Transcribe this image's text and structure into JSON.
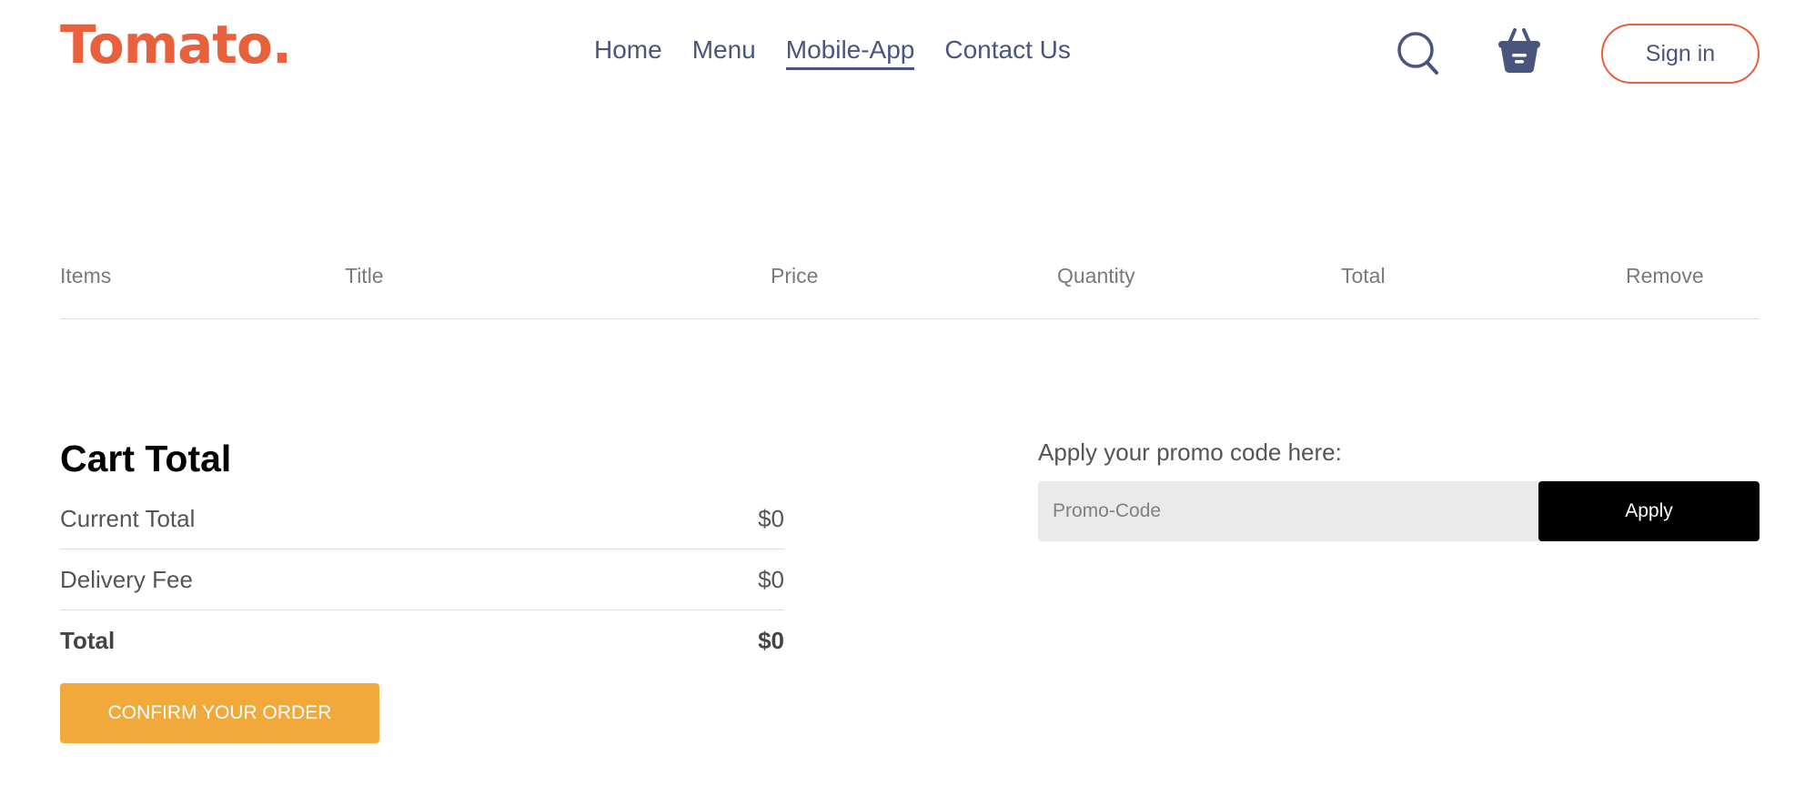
{
  "navbar": {
    "logo": "Tomato.",
    "menu": [
      {
        "label": "Home",
        "active": false
      },
      {
        "label": "Menu",
        "active": false
      },
      {
        "label": "Mobile-App",
        "active": true
      },
      {
        "label": "Contact Us",
        "active": false
      }
    ],
    "icons": {
      "search": "search-icon",
      "basket": "basket-icon"
    },
    "signin_label": "Sign in"
  },
  "cart_table": {
    "headers": [
      "Items",
      "Title",
      "Price",
      "Quantity",
      "Total",
      "Remove"
    ]
  },
  "cart_total": {
    "title": "Cart Total",
    "rows": [
      {
        "label": "Current Total",
        "value": "$0"
      },
      {
        "label": "Delivery Fee",
        "value": "$0"
      },
      {
        "label": "Total",
        "value": "$0"
      }
    ],
    "confirm_label": "CONFIRM YOUR ORDER"
  },
  "promo": {
    "label": "Apply your promo code here:",
    "placeholder": "Promo-Code",
    "value": "",
    "apply_label": "Apply"
  },
  "colors": {
    "brand": "#e8603c",
    "nav_text": "#49557e",
    "confirm_button": "#f1a93b",
    "apply_button": "#000000",
    "promo_bg": "#eaeaea"
  }
}
